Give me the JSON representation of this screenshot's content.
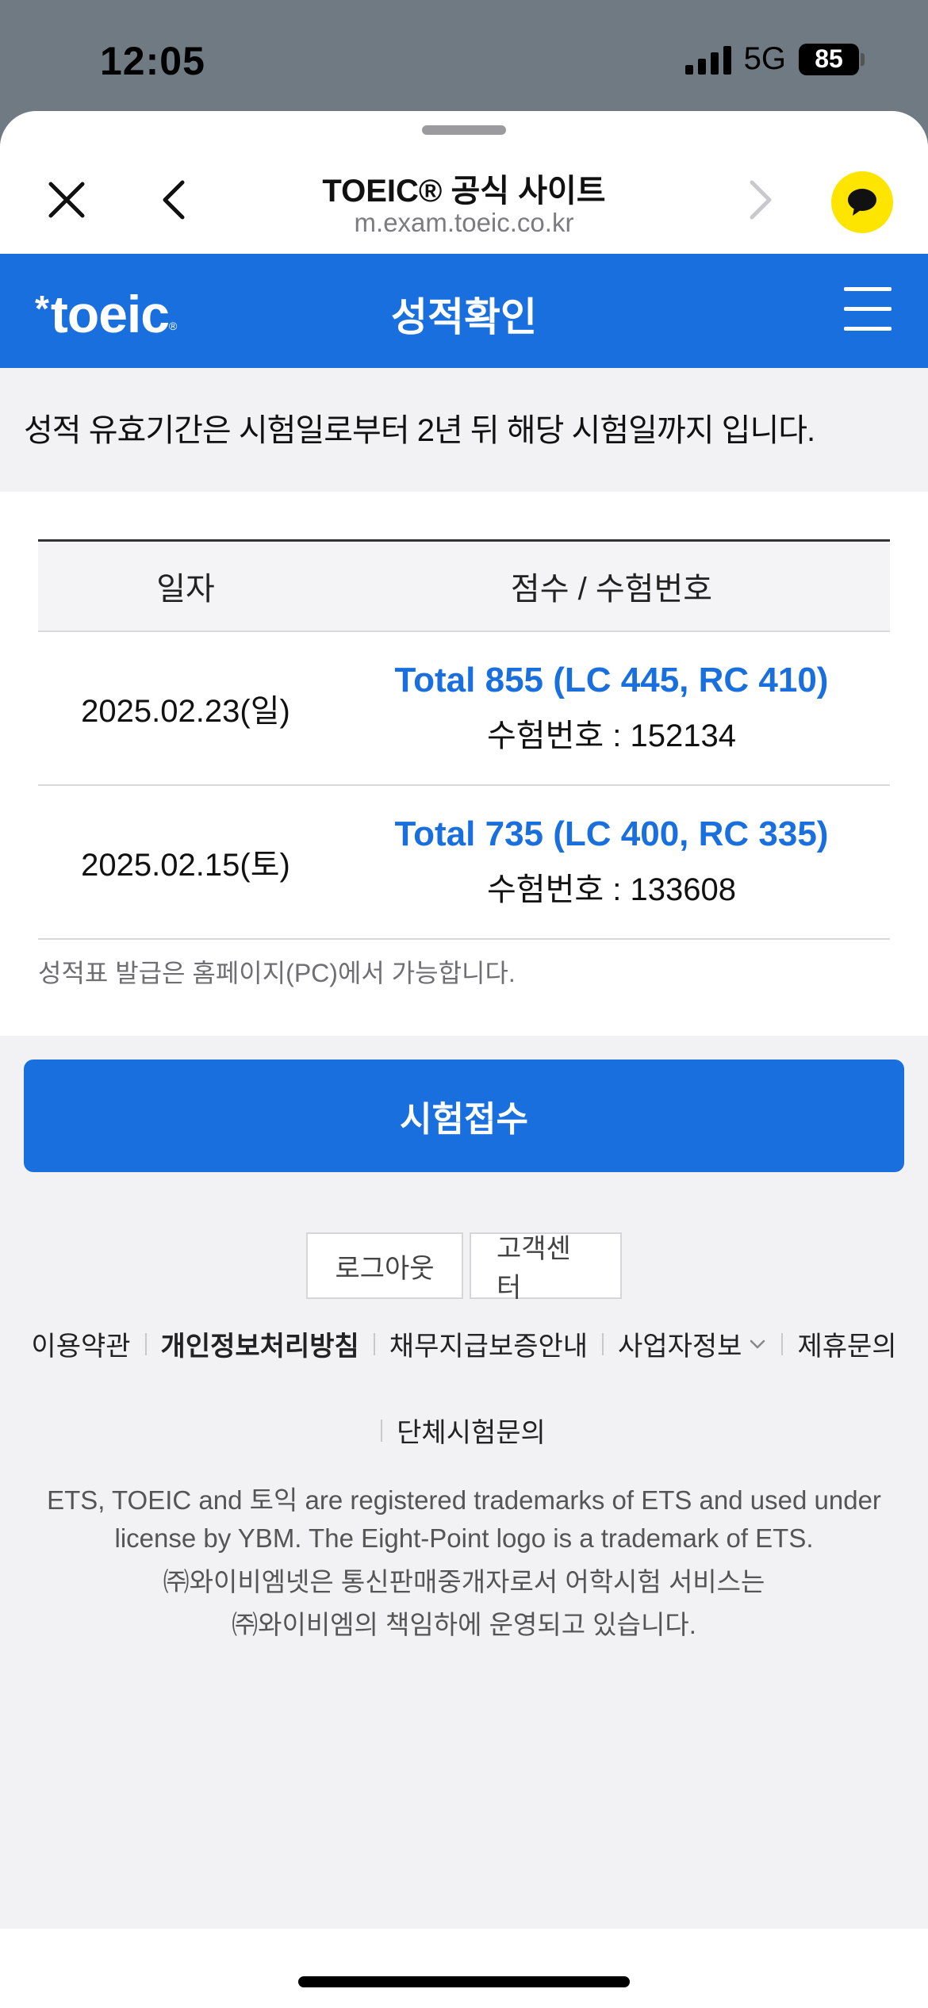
{
  "status_bar": {
    "time": "12:05",
    "network": "5G",
    "battery": "85"
  },
  "browser": {
    "title": "TOEIC® 공식 사이트",
    "url": "m.exam.toeic.co.kr"
  },
  "site_header": {
    "logo_text": "toeic",
    "logo_star": "*",
    "logo_reg": "®",
    "title": "성적확인"
  },
  "notice": {
    "text": "성적 유효기간은 시험일로부터 2년 뒤 해당 시험일까지 입니다."
  },
  "scores": {
    "headers": {
      "date": "일자",
      "score": "점수 / 수험번호"
    },
    "rows": [
      {
        "date": "2025.02.23(일)",
        "total": "Total 855 (LC 445, RC 410)",
        "exam_no": "수험번호 : 152134"
      },
      {
        "date": "2025.02.15(토)",
        "total": "Total 735 (LC 400, RC 335)",
        "exam_no": "수험번호 : 133608"
      }
    ],
    "note": "성적표 발급은 홈페이지(PC)에서 가능합니다."
  },
  "apply_button": "시험접수",
  "footer": {
    "logout": "로그아웃",
    "customer_center": "고객센터",
    "links": {
      "terms": "이용약관",
      "privacy": "개인정보처리방침",
      "guarantee": "채무지급보증안내",
      "business": "사업자정보",
      "partnership": "제휴문의",
      "group_exam": "단체시험문의"
    },
    "trademark_line1": "ETS, TOEIC and 토익 are registered trademarks of ETS and used under",
    "trademark_line2": "license by YBM. The Eight-Point logo is a trademark of ETS.",
    "company_line1": "㈜와이비엠넷은 통신판매중개자로서 어학시험 서비스는",
    "company_line2": "㈜와이비엠의 책임하에 운영되고 있습니다."
  },
  "colors": {
    "brand_blue": "#1a6fdf",
    "kakao_yellow": "#fee500"
  }
}
